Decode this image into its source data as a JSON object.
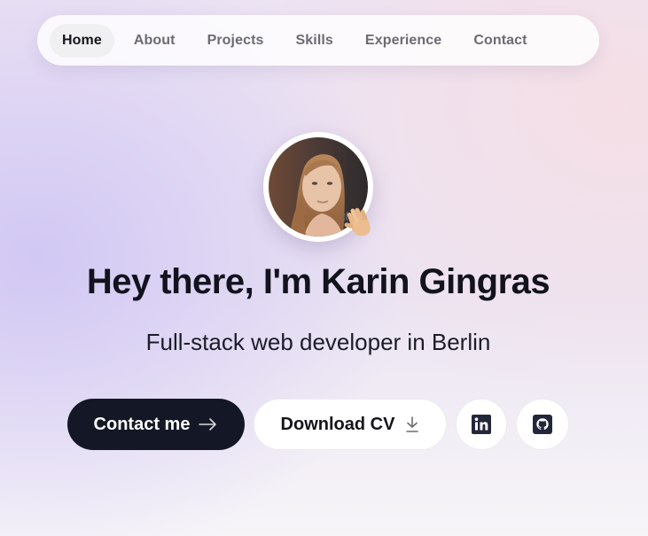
{
  "nav": {
    "items": [
      {
        "label": "Home",
        "active": true
      },
      {
        "label": "About",
        "active": false
      },
      {
        "label": "Projects",
        "active": false
      },
      {
        "label": "Skills",
        "active": false
      },
      {
        "label": "Experience",
        "active": false
      },
      {
        "label": "Contact",
        "active": false
      }
    ]
  },
  "hero": {
    "avatar": "profile-photo",
    "badge_icon": "waving-hand-icon",
    "title": "Hey there, I'm Karin Gingras",
    "subtitle": "Full-stack web developer in Berlin"
  },
  "actions": {
    "contact_label": "Contact me",
    "contact_icon": "arrow-right-icon",
    "cv_label": "Download CV",
    "cv_icon": "download-icon",
    "social": [
      {
        "icon": "linkedin-icon"
      },
      {
        "icon": "github-icon"
      }
    ]
  },
  "colors": {
    "primary_dark": "#141826",
    "text": "#12131d",
    "muted": "#6b6b72"
  }
}
